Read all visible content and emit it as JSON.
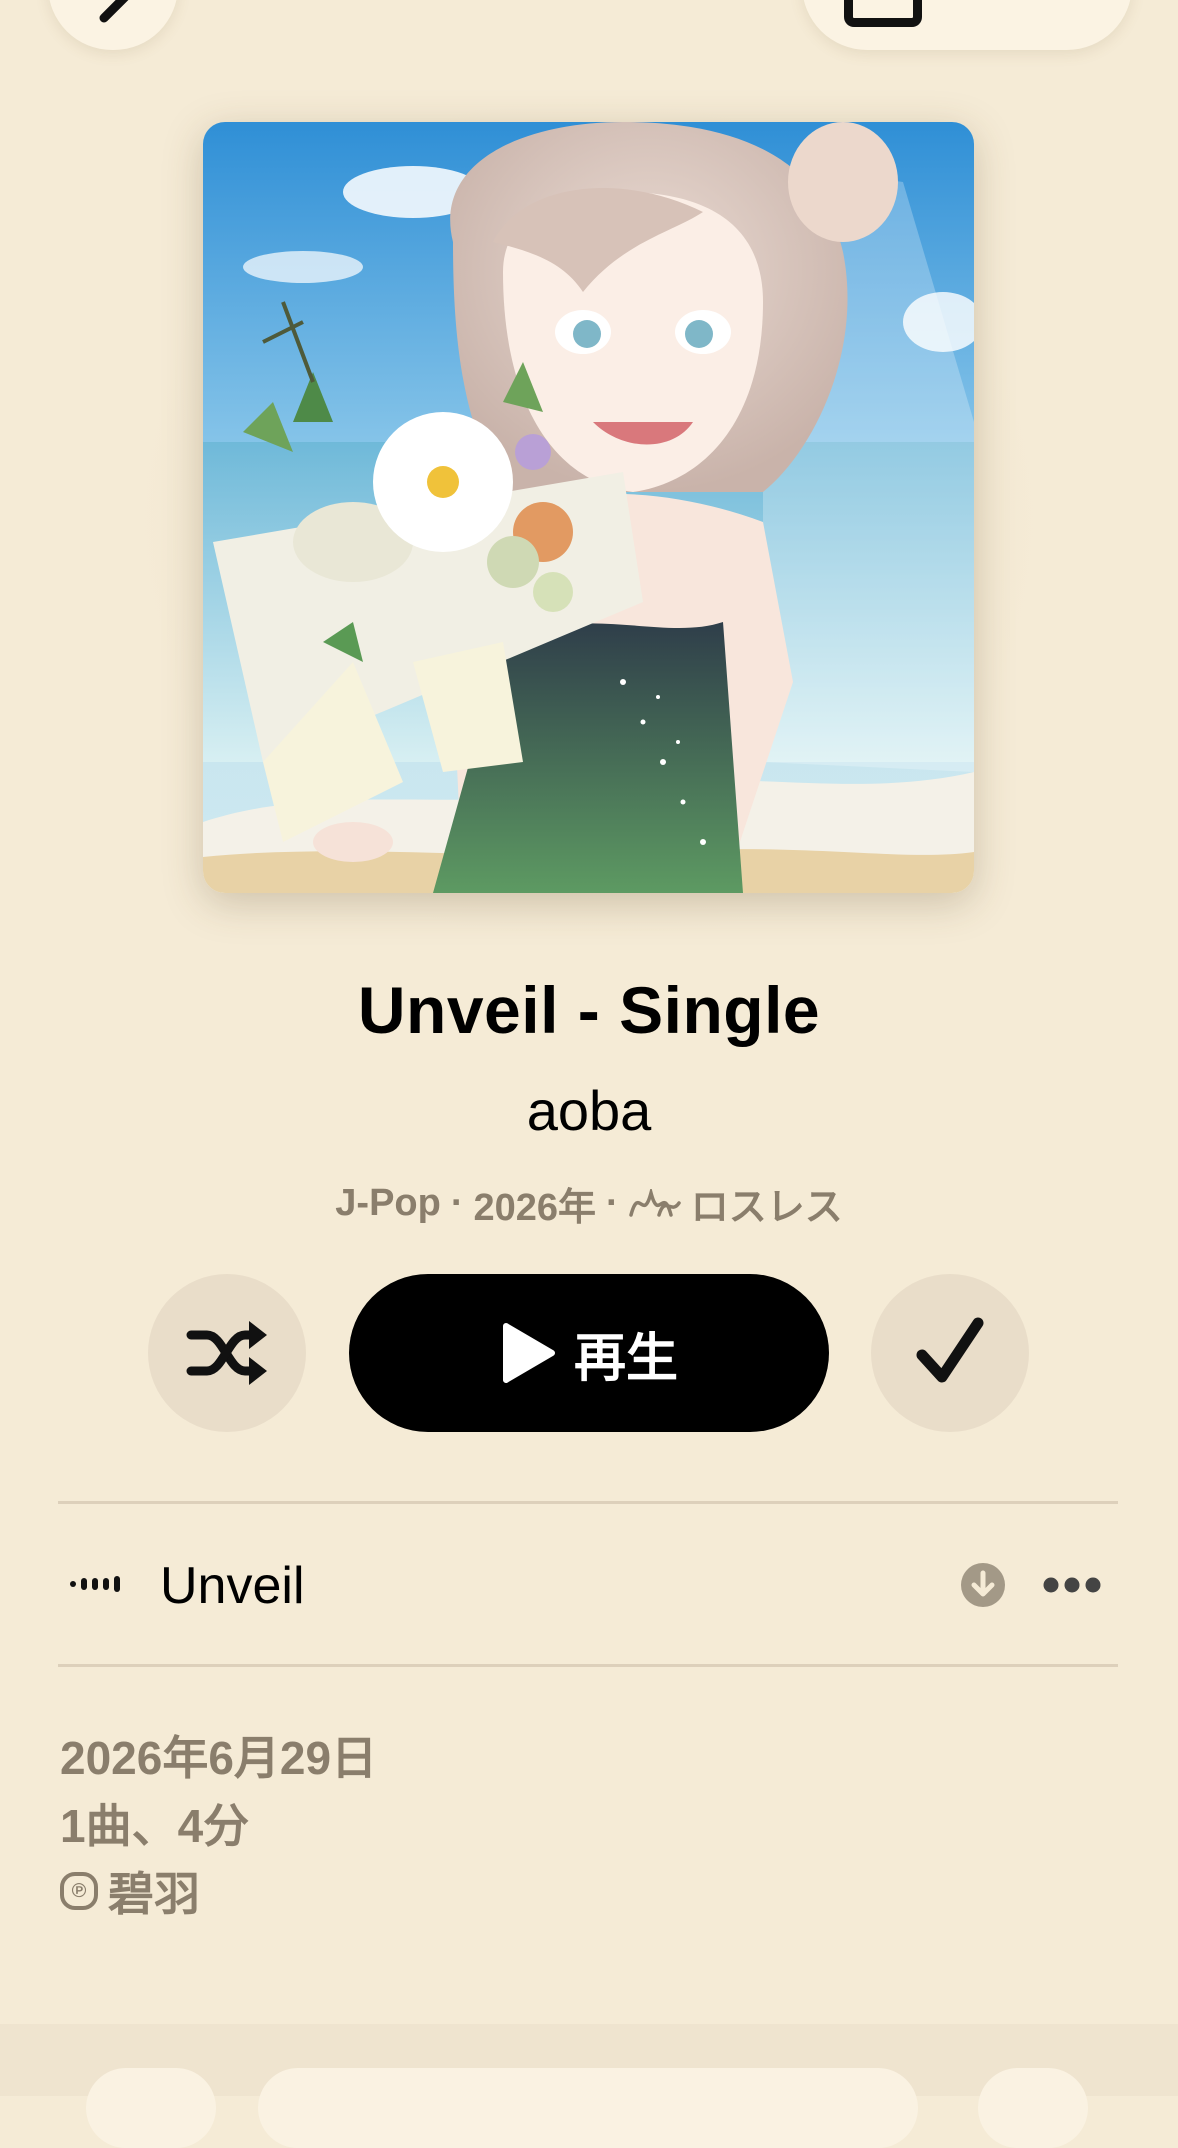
{
  "album": {
    "title": "Unveil - Single",
    "artist": "aoba",
    "genre": "J-Pop",
    "year": "2026年",
    "lossless_label": "ロスレス",
    "separator": "·"
  },
  "controls": {
    "play_label": "再生",
    "shuffle_icon": "shuffle-icon",
    "added_icon": "checkmark-icon"
  },
  "tracks": [
    {
      "title": "Unveil"
    }
  ],
  "footer": {
    "release_date": "2026年6月29日",
    "track_count": "1曲、4分",
    "copyright_symbol": "℗",
    "copyright_holder": "碧羽"
  },
  "colors": {
    "background": "#f5ebd6",
    "secondary_text": "#8a7e6c",
    "button_circle": "#e9ddc9",
    "play_button": "#000000"
  }
}
